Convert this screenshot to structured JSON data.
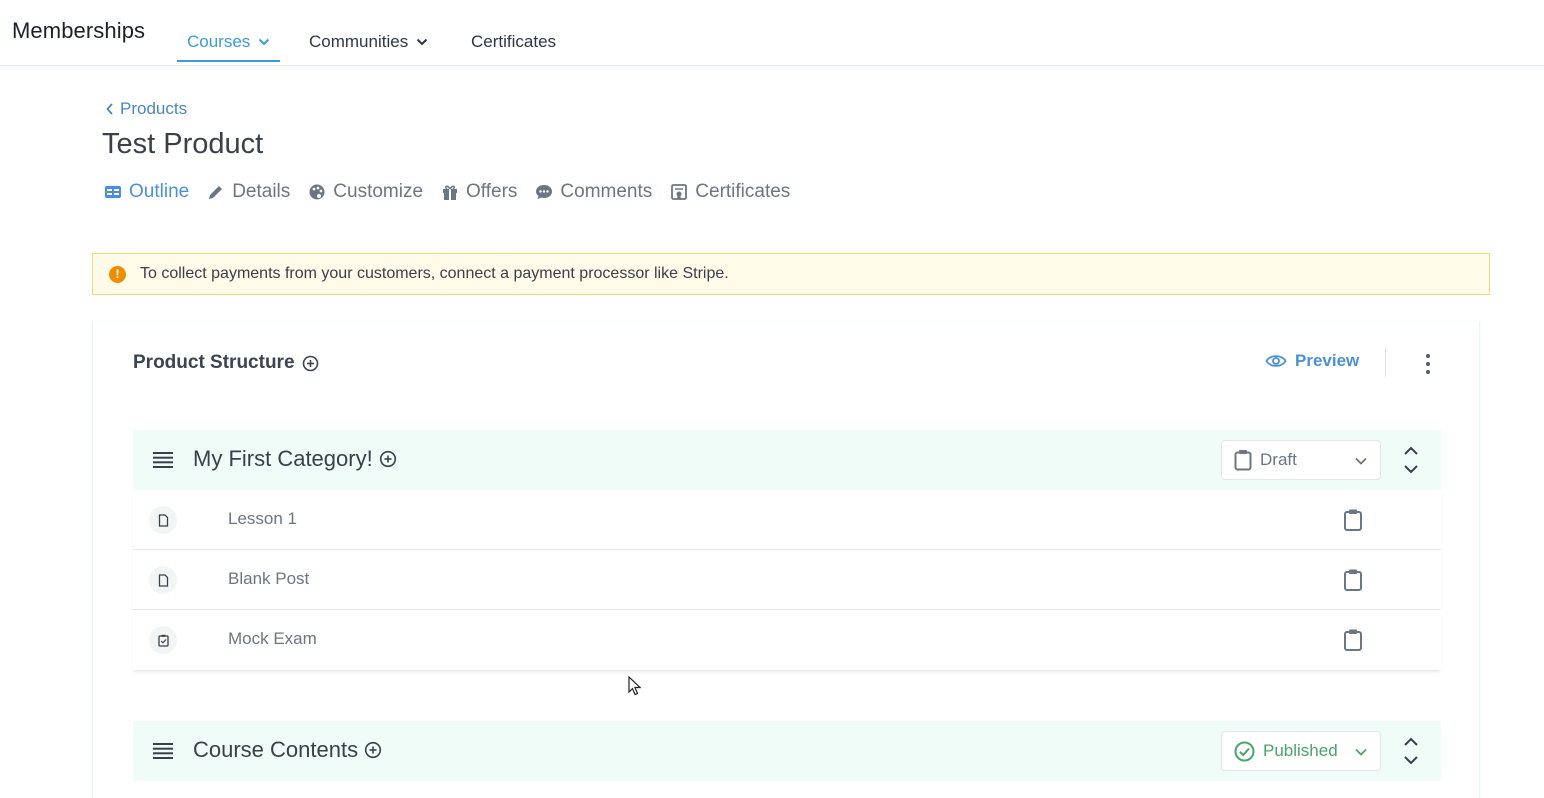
{
  "nav": {
    "brand": "Memberships",
    "items": [
      {
        "label": "Courses",
        "dropdown": true,
        "active": true
      },
      {
        "label": "Communities",
        "dropdown": true,
        "active": false
      },
      {
        "label": "Certificates",
        "dropdown": false,
        "active": false
      }
    ]
  },
  "header": {
    "back_label": "Products",
    "title": "Test Product",
    "tabs": [
      {
        "label": "Outline",
        "icon": "outline-icon",
        "active": true
      },
      {
        "label": "Details",
        "icon": "pencil-icon",
        "active": false
      },
      {
        "label": "Customize",
        "icon": "palette-icon",
        "active": false
      },
      {
        "label": "Offers",
        "icon": "gift-icon",
        "active": false
      },
      {
        "label": "Comments",
        "icon": "comment-icon",
        "active": false
      },
      {
        "label": "Certificates",
        "icon": "certificate-icon",
        "active": false
      }
    ]
  },
  "alert": {
    "text": "To collect payments from your customers, connect a payment processor like Stripe."
  },
  "structure": {
    "title": "Product Structure",
    "preview_label": "Preview",
    "categories": [
      {
        "name": "My First Category!",
        "status": "Draft",
        "items": [
          {
            "title": "Lesson 1",
            "icon": "document-icon"
          },
          {
            "title": "Blank Post",
            "icon": "document-icon"
          },
          {
            "title": "Mock Exam",
            "icon": "quiz-icon"
          }
        ]
      },
      {
        "name": "Course Contents",
        "status": "Published",
        "items": []
      }
    ]
  },
  "colors": {
    "accent": "#3a9bd8",
    "category_bg": "#effcf7",
    "alert_bg": "#fffbe8",
    "alert_border": "#f6d77a",
    "warning": "#f08c00",
    "published": "#4aa56a"
  }
}
